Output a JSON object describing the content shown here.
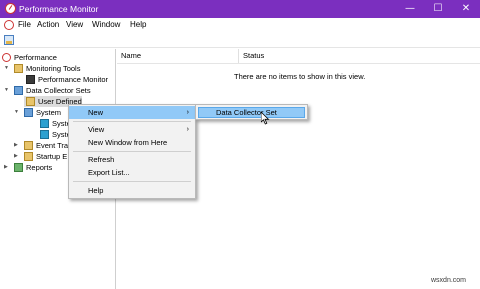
{
  "window": {
    "title": "Performance Monitor",
    "controls": [
      "—",
      "☐",
      "✕"
    ]
  },
  "menubar": {
    "items": [
      "File",
      "Action",
      "View",
      "Window",
      "Help"
    ]
  },
  "tree": {
    "root": "Performance",
    "monitoring_tools": "Monitoring Tools",
    "performance_monitor": "Performance Monitor",
    "data_collector_sets": "Data Collector Sets",
    "user_defined": "User Defined",
    "system": "System",
    "system_child_1": "Syste",
    "system_child_2": "Syste",
    "event_trace": "Event Tra",
    "startup": "Startup E",
    "reports": "Reports"
  },
  "list": {
    "columns": [
      "Name",
      "Status"
    ],
    "empty_message": "There are no items to show in this view."
  },
  "context_menu": {
    "new": "New",
    "view": "View",
    "new_window": "New Window from Here",
    "refresh": "Refresh",
    "export": "Export List...",
    "help": "Help"
  },
  "submenu": {
    "data_collector_set": "Data Collector Set"
  },
  "watermark": "wsxdn.com",
  "colors": {
    "titlebar": "#7b2fbf",
    "highlight": "#91c9f7"
  }
}
